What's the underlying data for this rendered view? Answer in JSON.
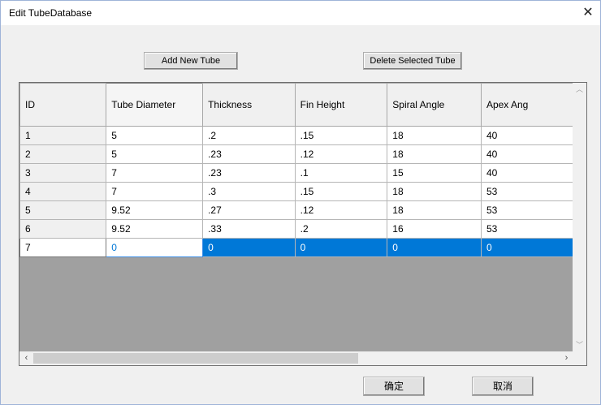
{
  "window": {
    "title": "Edit TubeDatabase"
  },
  "toolbar": {
    "add_label": "Add New Tube",
    "delete_label": "Delete Selected Tube"
  },
  "grid": {
    "columns": [
      "ID",
      "Tube Diameter",
      "Thickness",
      "Fin Height",
      "Spiral Angle",
      "Apex Ang"
    ],
    "rows": [
      [
        "1",
        "5",
        ".2",
        ".15",
        "18",
        "40"
      ],
      [
        "2",
        "5",
        ".23",
        ".12",
        "18",
        "40"
      ],
      [
        "3",
        "7",
        ".23",
        ".1",
        "15",
        "40"
      ],
      [
        "4",
        "7",
        ".3",
        ".15",
        "18",
        "53"
      ],
      [
        "5",
        "9.52",
        ".27",
        ".12",
        "18",
        "53"
      ],
      [
        "6",
        "9.52",
        ".33",
        ".2",
        "16",
        "53"
      ],
      [
        "7",
        "0",
        "0",
        "0",
        "0",
        "0"
      ]
    ],
    "selected_row": "7"
  },
  "dialog_buttons": {
    "ok_label": "确定",
    "cancel_label": "取消"
  },
  "colors": {
    "selection": "#0078d7",
    "empty_area": "#a0a0a0"
  }
}
